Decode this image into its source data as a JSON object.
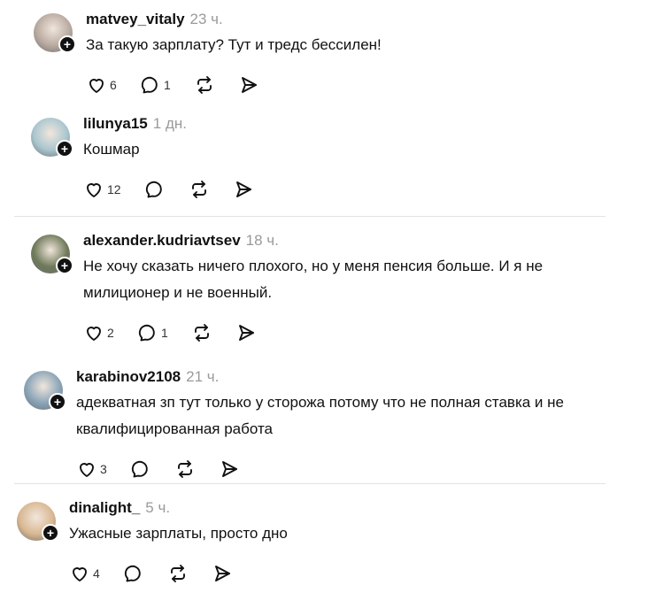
{
  "comments": [
    {
      "username": "matvey_vitaly",
      "time": "23 ч.",
      "lines": [
        "За такую зарплату? Тут и тредс бессилен!"
      ],
      "likes": "6",
      "replies": "1",
      "avatar_color": "#b9aaa0"
    },
    {
      "username": "lilunya15",
      "time": "1 дн.",
      "lines": [
        "Кошмар"
      ],
      "likes": "12",
      "replies": "",
      "avatar_color": "#a9c6cf"
    },
    {
      "username": "alexander.kudriavtsev",
      "time": "18 ч.",
      "lines": [
        "Не хочу сказать ничего плохого, но у меня пенсия больше. И я не",
        "милиционер и не военный."
      ],
      "likes": "2",
      "replies": "1",
      "avatar_color": "#6f7a5a"
    },
    {
      "username": "karabinov2108",
      "time": "21 ч.",
      "lines": [
        "адекватная зп тут только у сторожа потому что не полная ставка и не",
        "квалифицированная работа"
      ],
      "likes": "3",
      "replies": "",
      "avatar_color": "#8aa4b8"
    },
    {
      "username": "dinalight_",
      "time": "5 ч.",
      "lines": [
        "Ужасные зарплаты, просто дно"
      ],
      "likes": "4",
      "replies": "",
      "avatar_color": "#d9b892"
    }
  ],
  "icons": {
    "like": "heart-icon",
    "reply": "comment-icon",
    "repost": "repost-icon",
    "share": "share-icon",
    "follow": "plus-icon"
  },
  "colors": {
    "text": "#111111",
    "muted": "#9a9a9a",
    "divider": "#e3e3e3"
  }
}
